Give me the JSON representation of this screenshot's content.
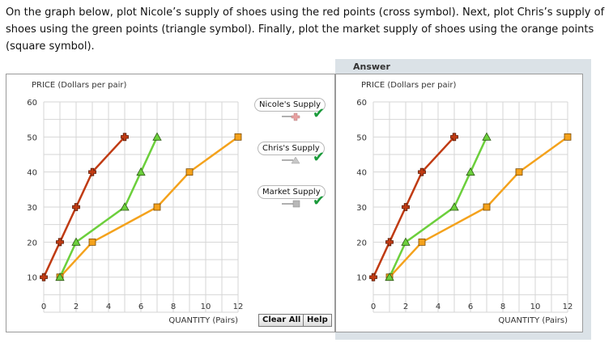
{
  "instructions": "On the graph below, plot Nicole’s supply of shoes using the red points (cross symbol). Next, plot Chris’s supply of shoes using the green points (triangle symbol). Finally, plot the market supply of shoes using the orange points (square symbol).",
  "answer_label": "Answer",
  "legend": {
    "nicole": "Nicole's Supply",
    "chris": "Chris's Supply",
    "market": "Market Supply",
    "check_icon": "checkmark"
  },
  "buttons": {
    "clear": "Clear All",
    "help": "Help"
  },
  "colors": {
    "nicole": "#c03b13",
    "chris": "#6ccf3c",
    "market": "#f4a21c",
    "grid": "#d6d6d6",
    "check": "#1a9a3a"
  },
  "chart_data": [
    {
      "type": "line",
      "ylabel": "PRICE (Dollars per pair)",
      "xlabel": "QUANTITY (Pairs)",
      "xlim": [
        0,
        12
      ],
      "ylim": [
        0,
        60
      ],
      "xticks": [
        0,
        2,
        4,
        6,
        8,
        10,
        12
      ],
      "yticks": [
        10,
        20,
        30,
        40,
        50,
        60
      ],
      "grid": true,
      "series": [
        {
          "name": "Nicole's Supply",
          "marker": "cross",
          "color": "#c03b13",
          "points": [
            [
              0,
              10
            ],
            [
              1,
              20
            ],
            [
              2,
              30
            ],
            [
              3,
              40
            ],
            [
              5,
              50
            ]
          ]
        },
        {
          "name": "Chris's Supply",
          "marker": "triangle",
          "color": "#6ccf3c",
          "points": [
            [
              1,
              10
            ],
            [
              2,
              20
            ],
            [
              5,
              30
            ],
            [
              6,
              40
            ],
            [
              7,
              50
            ]
          ]
        },
        {
          "name": "Market Supply",
          "marker": "square",
          "color": "#f4a21c",
          "points": [
            [
              1,
              10
            ],
            [
              3,
              20
            ],
            [
              7,
              30
            ],
            [
              9,
              40
            ],
            [
              12,
              50
            ]
          ]
        }
      ]
    },
    {
      "type": "line",
      "ylabel": "PRICE (Dollars per pair)",
      "xlabel": "QUANTITY (Pairs)",
      "xlim": [
        0,
        12
      ],
      "ylim": [
        0,
        60
      ],
      "xticks": [
        0,
        2,
        4,
        6,
        8,
        10,
        12
      ],
      "yticks": [
        10,
        20,
        30,
        40,
        50,
        60
      ],
      "grid": true,
      "series": [
        {
          "name": "Nicole's Supply",
          "marker": "cross",
          "color": "#c03b13",
          "points": [
            [
              0,
              10
            ],
            [
              1,
              20
            ],
            [
              2,
              30
            ],
            [
              3,
              40
            ],
            [
              5,
              50
            ]
          ]
        },
        {
          "name": "Chris's Supply",
          "marker": "triangle",
          "color": "#6ccf3c",
          "points": [
            [
              1,
              10
            ],
            [
              2,
              20
            ],
            [
              5,
              30
            ],
            [
              6,
              40
            ],
            [
              7,
              50
            ]
          ]
        },
        {
          "name": "Market Supply",
          "marker": "square",
          "color": "#f4a21c",
          "points": [
            [
              1,
              10
            ],
            [
              3,
              20
            ],
            [
              7,
              30
            ],
            [
              9,
              40
            ],
            [
              12,
              50
            ]
          ]
        }
      ]
    }
  ]
}
